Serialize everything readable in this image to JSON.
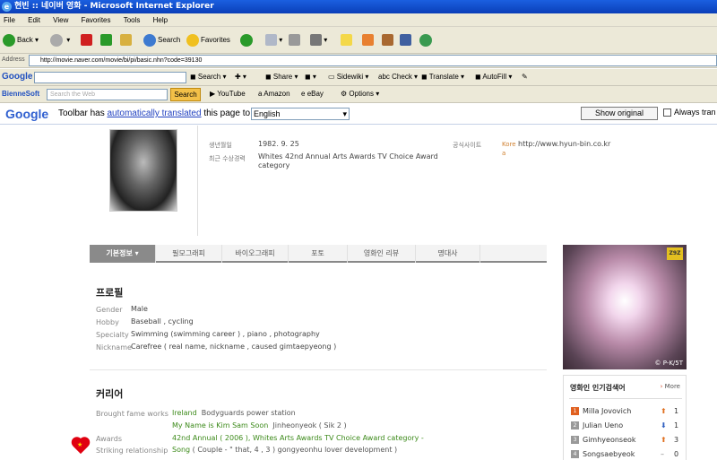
{
  "window": {
    "title": "현빈 :: 네이버 영화 - Microsoft Internet Explorer"
  },
  "menu": [
    "File",
    "Edit",
    "View",
    "Favorites",
    "Tools",
    "Help"
  ],
  "toolbar": {
    "back": "Back",
    "search": "Search",
    "favorites": "Favorites"
  },
  "address": {
    "label": "Address",
    "url": "http://movie.naver.com/movie/bi/pi/basic.nhn?code=39130"
  },
  "google_toolbar": {
    "label": "Google",
    "search_btn": "Search",
    "share": "Share",
    "sidewiki": "Sidewiki",
    "check": "Check",
    "translate": "Translate",
    "autofill": "AutoFill"
  },
  "yahoo_toolbar": {
    "label": "BienneSoft",
    "search_placeholder": "Search the Web",
    "search_btn": "Search",
    "youtube": "YouTube",
    "amazon": "Amazon",
    "ebay": "eBay",
    "options": "Options"
  },
  "translate_bar": {
    "logo": "Google",
    "msg_prefix": "Toolbar has",
    "msg_link": "automatically translated",
    "msg_suffix": "this page to",
    "language": "English",
    "show_original": "Show original",
    "always": "Always tran"
  },
  "info": {
    "birth_label": "생년월일",
    "birth_value": "1982. 9. 25",
    "award_label": "최근 수상경력",
    "award_value": "Whites 42nd Annual Arts Awards TV Choice Award category",
    "site_label": "공식사이트",
    "site_lang": "Kore",
    "site_url": "http://www.hyun-bin.co.kr",
    "site_extra": "a"
  },
  "tabs": [
    "기본정보 ▾",
    "필모그래피",
    "바이오그래피",
    "포토",
    "영화인 리뷰",
    "명대사"
  ],
  "profile": {
    "title": "프로필",
    "rows": [
      {
        "label": "Gender",
        "value": "Male"
      },
      {
        "label": "Hobby",
        "value": "Baseball , cycling"
      },
      {
        "label": "Specialty",
        "value": "Swimming (swimming career ) , piano , photography"
      },
      {
        "label": "Nickname",
        "value": "Carefree ( real name, nickname , caused gimtaepyeong )"
      }
    ]
  },
  "career": {
    "title": "커리어",
    "fame_label": "Brought fame works",
    "fame1_title": "Ireland",
    "fame1_rest": "Bodyguards power station",
    "fame2_title": "My Name is Kim Sam Soon",
    "fame2_rest": "Jinheonyeok ( Sik 2 )",
    "awards_label": "Awards",
    "awards_value": "42nd Annual ( 2006 ), Whites Arts Awards TV Choice Award category -",
    "striking_label": "Striking relationship",
    "striking_title": "Song",
    "striking_rest": "( Couple - \" that, 4 , 3 ) gongyeonhu lover development )"
  },
  "banner": {
    "tag": "Z9Z",
    "caption": "© P-K/5T"
  },
  "popular": {
    "title": "영화인 인기검색어",
    "more": "More",
    "items": [
      {
        "rank": "1",
        "name": "Milla Jovovich",
        "trend": "⬆",
        "count": "1"
      },
      {
        "rank": "2",
        "name": "Julian Ueno",
        "trend": "⬇",
        "count": "1"
      },
      {
        "rank": "3",
        "name": "Gimhyeonseok",
        "trend": "⬆",
        "count": "3"
      },
      {
        "rank": "4",
        "name": "Songsaebyeok",
        "trend": "–",
        "count": "0"
      }
    ]
  },
  "colors": {
    "ie_title": "#0a3fb8",
    "accent_green": "#3c8a1a",
    "heart": "#e00010"
  }
}
